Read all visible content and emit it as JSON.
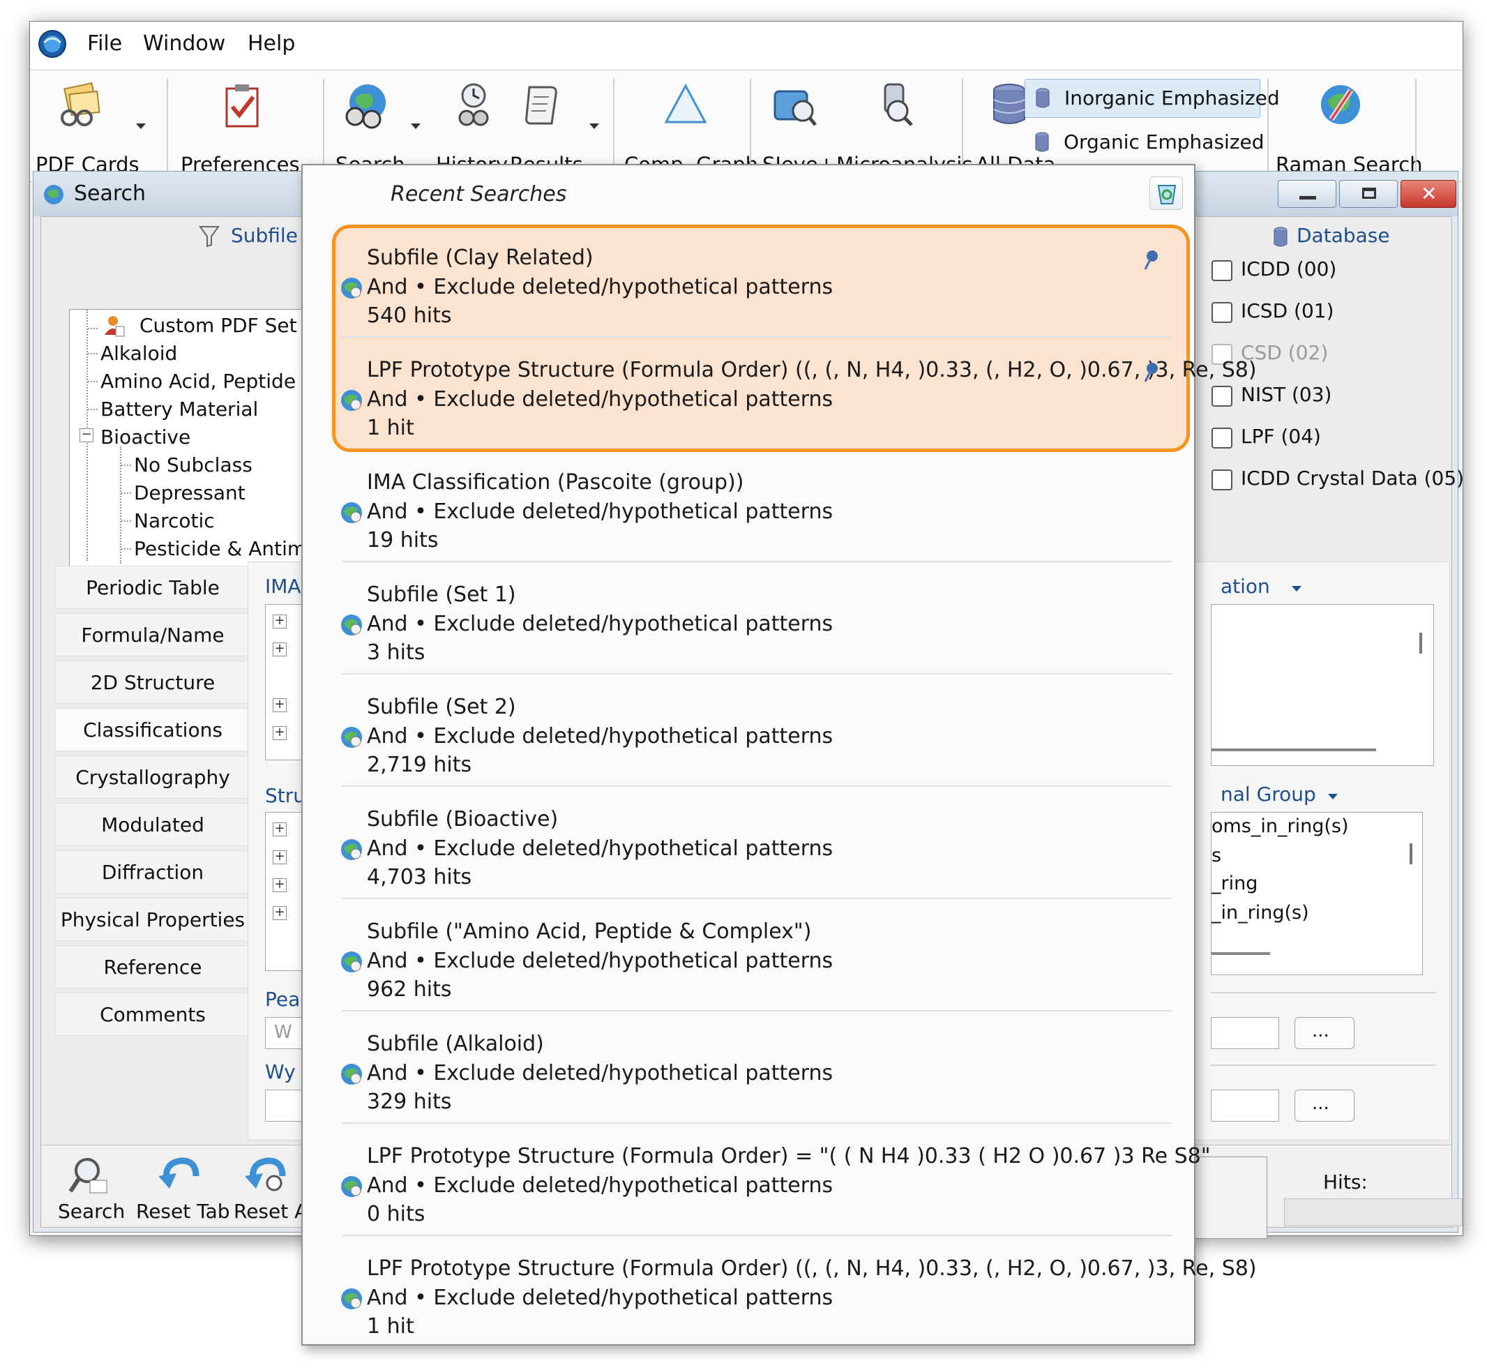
{
  "menubar": {
    "items": [
      "File",
      "Window",
      "Help"
    ]
  },
  "toolbar": {
    "pdf_cards": "PDF Cards",
    "preferences": "Preferences",
    "search": "Search",
    "history": "History",
    "results": "Results",
    "comp_graph": "Comp. Graph",
    "sieve": "SIeve+",
    "microanalysis": "Microanalysis",
    "all_data": "All Data",
    "inorganic": "Inorganic Emphasized",
    "organic": "Organic Emphasized",
    "raman": "Raman Search"
  },
  "search_window": {
    "title": "Search",
    "subfile_header": "Subfile",
    "database_header": "Database",
    "tree": [
      "Custom PDF Set",
      "Alkaloid",
      "Amino Acid, Peptide & C",
      "Battery Material",
      "Bioactive",
      "No Subclass",
      "Depressant",
      "Narcotic",
      "Pesticide & Antimicro"
    ],
    "tabs": [
      "Periodic Table",
      "Formula/Name",
      "2D Structure",
      "Classifications",
      "Crystallography",
      "Modulated",
      "Diffraction",
      "Physical Properties",
      "Reference",
      "Comments"
    ],
    "selected_tab": "Classifications",
    "databases": [
      {
        "label": "ICDD (00)",
        "enabled": true
      },
      {
        "label": "ICSD (01)",
        "enabled": true
      },
      {
        "label": "CSD (02)",
        "enabled": false
      },
      {
        "label": "NIST (03)",
        "enabled": true
      },
      {
        "label": "LPF (04)",
        "enabled": true
      },
      {
        "label": "ICDD Crystal Data (05)",
        "enabled": true
      }
    ],
    "center": {
      "ima_label": "IMA",
      "stru_label": "Stru",
      "pea_label": "Pea",
      "wy_label": "Wy",
      "w_placeholder": "W",
      "ation_label": "ation",
      "nal_group_label": "nal Group",
      "group_items": [
        "oms_in_ring(s)",
        "s",
        "_ring",
        "_in_ring(s)"
      ],
      "ellipsis": "..."
    },
    "bottom": {
      "search": "Search",
      "reset_tab": "Reset Tab",
      "reset_all": "Reset A",
      "hits_label": "Hits:"
    }
  },
  "dropdown": {
    "header": "Recent Searches",
    "items": [
      {
        "l1": "Subfile (Clay Related)",
        "l2": "And • Exclude deleted/hypothetical patterns",
        "l3": "540 hits"
      },
      {
        "l1": "LPF Prototype Structure (Formula Order) ((, (, N, H4, )0.33, (, H2, O, )0.67, )3, Re, S8)",
        "l2": "And • Exclude deleted/hypothetical patterns",
        "l3": "1 hit"
      },
      {
        "l1": "IMA Classification (Pascoite (group))",
        "l2": "And • Exclude deleted/hypothetical patterns",
        "l3": "19 hits"
      },
      {
        "l1": "Subfile (Set 1)",
        "l2": "And • Exclude deleted/hypothetical patterns",
        "l3": "3 hits"
      },
      {
        "l1": "Subfile (Set 2)",
        "l2": "And • Exclude deleted/hypothetical patterns",
        "l3": "2,719 hits"
      },
      {
        "l1": "Subfile (Bioactive)",
        "l2": "And • Exclude deleted/hypothetical patterns",
        "l3": "4,703 hits"
      },
      {
        "l1": "Subfile (\"Amino Acid, Peptide & Complex\")",
        "l2": "And • Exclude deleted/hypothetical patterns",
        "l3": "962 hits"
      },
      {
        "l1": "Subfile (Alkaloid)",
        "l2": "And • Exclude deleted/hypothetical patterns",
        "l3": "329 hits"
      },
      {
        "l1": "LPF Prototype Structure (Formula Order) = \"( ( N H4 )0.33 ( H2 O )0.67 )3 Re S8\"",
        "l2": "And • Exclude deleted/hypothetical patterns",
        "l3": "0 hits"
      },
      {
        "l1": "LPF Prototype Structure (Formula Order) ((, (, N, H4, )0.33, (, H2, O, )0.67, )3, Re, S8)",
        "l2": "And • Exclude deleted/hypothetical patterns",
        "l3": "1 hit"
      }
    ]
  },
  "colors": {
    "highlight_border": "#f7941d",
    "highlight_fill": "#fbe3cf",
    "link_blue": "#1f4e8c"
  }
}
